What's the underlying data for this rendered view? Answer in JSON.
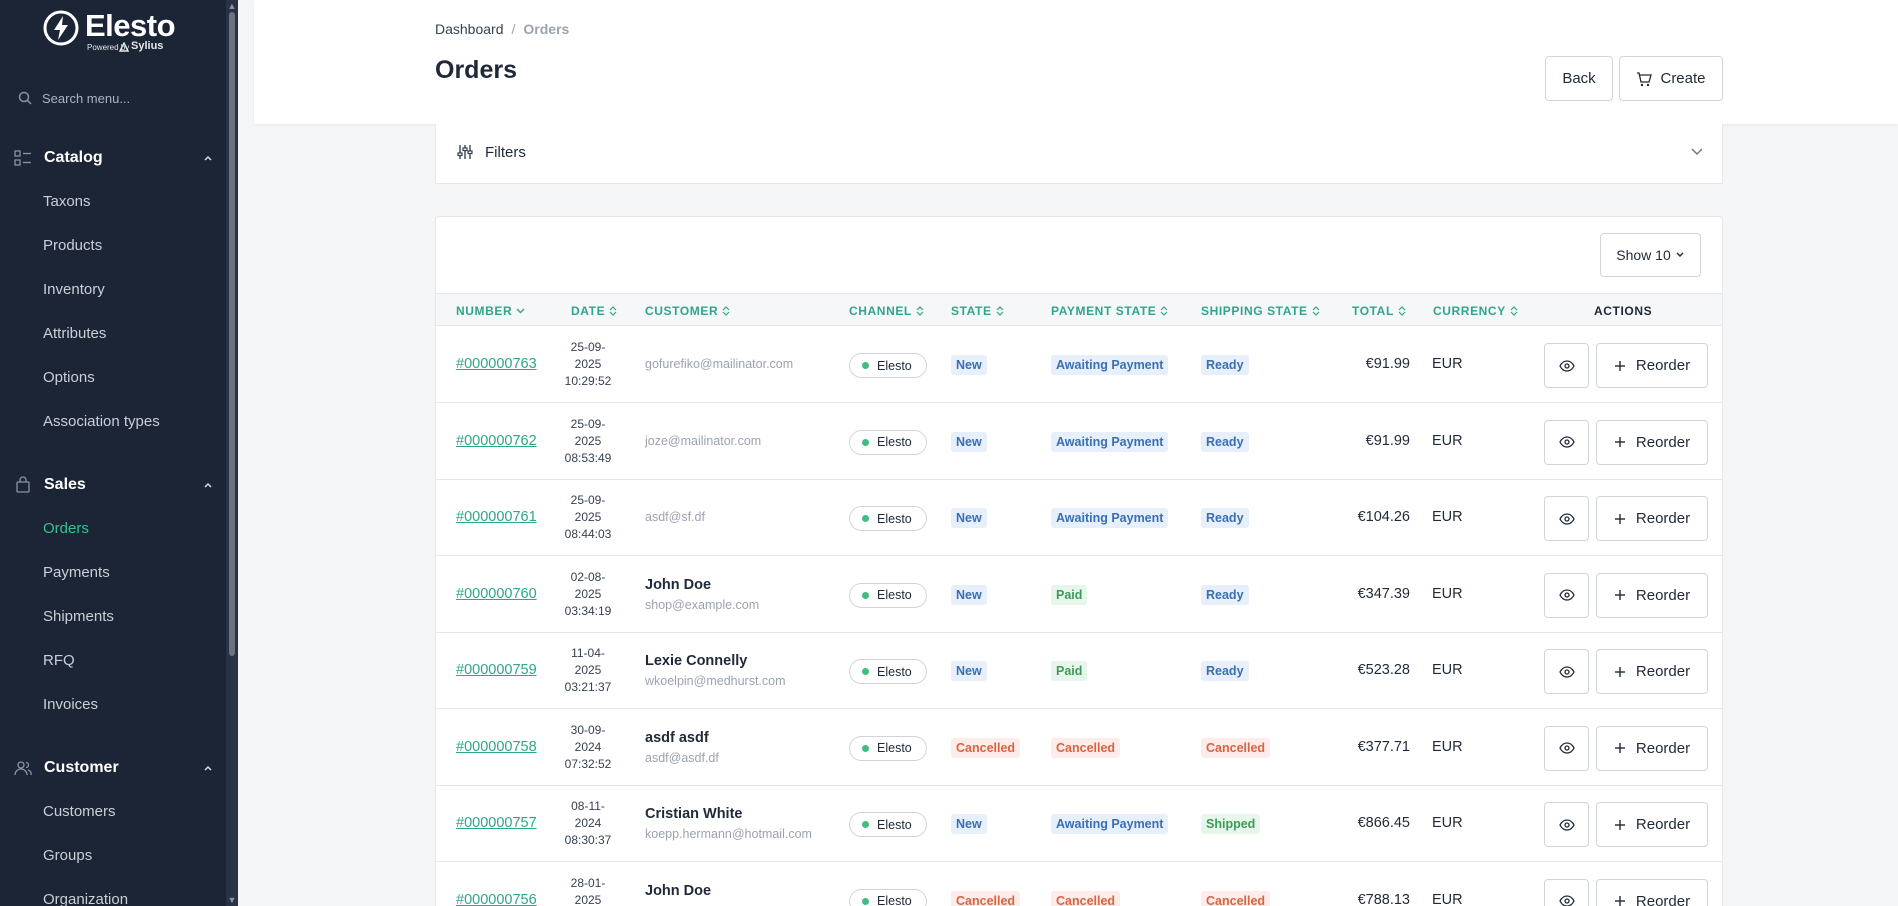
{
  "brand": {
    "name": "Elesto",
    "powered_by": "Powered by",
    "sylius": "Sylius"
  },
  "sidebar": {
    "search_placeholder": "Search menu...",
    "sections": [
      {
        "label": "Catalog",
        "icon": "catalog-icon",
        "items": [
          "Taxons",
          "Products",
          "Inventory",
          "Attributes",
          "Options",
          "Association types"
        ]
      },
      {
        "label": "Sales",
        "icon": "bag-icon",
        "items": [
          "Orders",
          "Payments",
          "Shipments",
          "RFQ",
          "Invoices"
        ]
      },
      {
        "label": "Customer",
        "icon": "users-icon",
        "items": [
          "Customers",
          "Groups",
          "Organization"
        ]
      }
    ],
    "active_item": "Orders"
  },
  "header": {
    "breadcrumb": [
      "Dashboard",
      "Orders"
    ],
    "title": "Orders",
    "back_label": "Back",
    "create_label": "Create"
  },
  "filters": {
    "label": "Filters"
  },
  "table": {
    "show_label": "Show 10",
    "columns": [
      "NUMBER",
      "DATE",
      "CUSTOMER",
      "CHANNEL",
      "STATE",
      "PAYMENT STATE",
      "SHIPPING STATE",
      "TOTAL",
      "CURRENCY",
      "ACTIONS"
    ],
    "reorder_label": "Reorder",
    "rows": [
      {
        "number": "#000000763",
        "date": [
          "25-09-",
          "2025",
          "10:29:52"
        ],
        "name": "",
        "email": "gofurefiko@mailinator.com",
        "channel": "Elesto",
        "state": "New",
        "state_color": "blue",
        "payment": "Awaiting Payment",
        "payment_color": "blue",
        "shipping": "Ready",
        "shipping_color": "blue",
        "total": "€91.99",
        "currency": "EUR"
      },
      {
        "number": "#000000762",
        "date": [
          "25-09-",
          "2025",
          "08:53:49"
        ],
        "name": "",
        "email": "joze@mailinator.com",
        "channel": "Elesto",
        "state": "New",
        "state_color": "blue",
        "payment": "Awaiting Payment",
        "payment_color": "blue",
        "shipping": "Ready",
        "shipping_color": "blue",
        "total": "€91.99",
        "currency": "EUR"
      },
      {
        "number": "#000000761",
        "date": [
          "25-09-",
          "2025",
          "08:44:03"
        ],
        "name": "",
        "email": "asdf@sf.df",
        "channel": "Elesto",
        "state": "New",
        "state_color": "blue",
        "payment": "Awaiting Payment",
        "payment_color": "blue",
        "shipping": "Ready",
        "shipping_color": "blue",
        "total": "€104.26",
        "currency": "EUR"
      },
      {
        "number": "#000000760",
        "date": [
          "02-08-",
          "2025",
          "03:34:19"
        ],
        "name": "John Doe",
        "email": "shop@example.com",
        "channel": "Elesto",
        "state": "New",
        "state_color": "blue",
        "payment": "Paid",
        "payment_color": "green",
        "shipping": "Ready",
        "shipping_color": "blue",
        "total": "€347.39",
        "currency": "EUR"
      },
      {
        "number": "#000000759",
        "date": [
          "11-04-",
          "2025",
          "03:21:37"
        ],
        "name": "Lexie Connelly",
        "email": "wkoelpin@medhurst.com",
        "channel": "Elesto",
        "state": "New",
        "state_color": "blue",
        "payment": "Paid",
        "payment_color": "green",
        "shipping": "Ready",
        "shipping_color": "blue",
        "total": "€523.28",
        "currency": "EUR"
      },
      {
        "number": "#000000758",
        "date": [
          "30-09-",
          "2024",
          "07:32:52"
        ],
        "name": "asdf asdf",
        "email": "asdf@asdf.df",
        "channel": "Elesto",
        "state": "Cancelled",
        "state_color": "red",
        "payment": "Cancelled",
        "payment_color": "red",
        "shipping": "Cancelled",
        "shipping_color": "red",
        "total": "€377.71",
        "currency": "EUR"
      },
      {
        "number": "#000000757",
        "date": [
          "08-11-",
          "2024",
          "08:30:37"
        ],
        "name": "Cristian White",
        "email": "koepp.hermann@hotmail.com",
        "channel": "Elesto",
        "state": "New",
        "state_color": "blue",
        "payment": "Awaiting Payment",
        "payment_color": "blue",
        "shipping": "Shipped",
        "shipping_color": "green",
        "total": "€866.45",
        "currency": "EUR"
      },
      {
        "number": "#000000756",
        "date": [
          "28-01-",
          "2025",
          ""
        ],
        "name": "John Doe",
        "email": "",
        "channel": "Elesto",
        "state": "Cancelled",
        "state_color": "red",
        "payment": "Cancelled",
        "payment_color": "red",
        "shipping": "Cancelled",
        "shipping_color": "red",
        "total": "€788.13",
        "currency": "EUR"
      }
    ]
  }
}
